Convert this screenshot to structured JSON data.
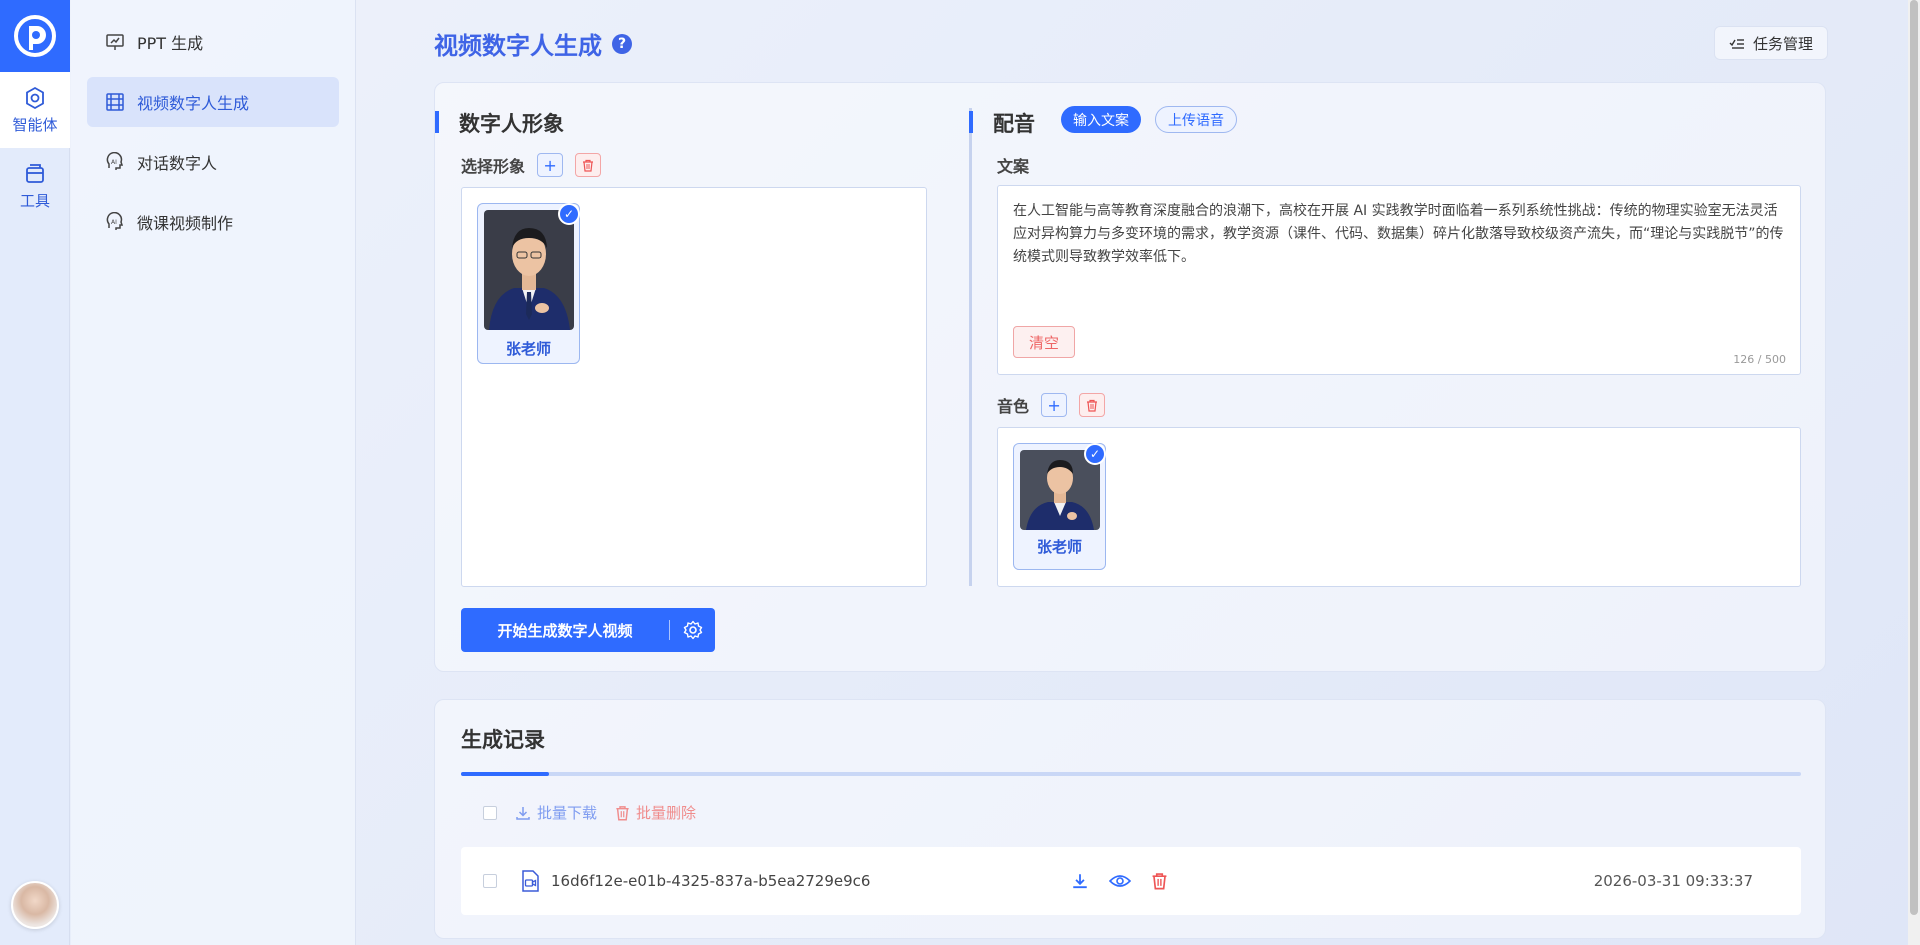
{
  "rail": {
    "items": [
      {
        "label": "智能体",
        "icon": "agent-icon",
        "active": true
      },
      {
        "label": "工具",
        "icon": "toolbox-icon",
        "active": false
      }
    ]
  },
  "sidenav": {
    "items": [
      {
        "label": "PPT 生成",
        "icon": "presentation-icon",
        "active": false
      },
      {
        "label": "视频数字人生成",
        "icon": "film-icon",
        "active": true
      },
      {
        "label": "对话数字人",
        "icon": "ai-head-icon",
        "active": false
      },
      {
        "label": "微课视频制作",
        "icon": "ai-head-icon",
        "active": false
      }
    ]
  },
  "header": {
    "title": "视频数字人生成",
    "help": "?",
    "task_button": "任务管理"
  },
  "avatar_section": {
    "title": "数字人形象",
    "select_label": "选择形象",
    "figure_name": "张老师"
  },
  "dubbing": {
    "title": "配音",
    "tabs": [
      "输入文案",
      "上传语音"
    ],
    "text_label": "文案",
    "text": "在人工智能与高等教育深度融合的浪潮下，高校在开展 AI 实践教学时面临着一系列系统性挑战：传统的物理实验室无法灵活应对异构算力与多变环境的需求，教学资源（课件、代码、数据集）碎片化散落导致校级资产流失，而“理论与实践脱节”的传统模式则导致教学效率低下。",
    "clear_button": "清空",
    "char_count": "126 / 500",
    "voice_label": "音色",
    "voice_name": "张老师"
  },
  "generate_button": "开始生成数字人视频",
  "records": {
    "title": "生成记录",
    "batch_download": "批量下载",
    "batch_delete": "批量删除",
    "rows": [
      {
        "file": "16d6f12e-e01b-4325-837a-b5ea2729e9c6",
        "time": "2026-03-31 09:33:37"
      }
    ]
  },
  "colors": {
    "primary": "#2f6bff",
    "title": "#3f64e6",
    "danger": "#e55555"
  }
}
